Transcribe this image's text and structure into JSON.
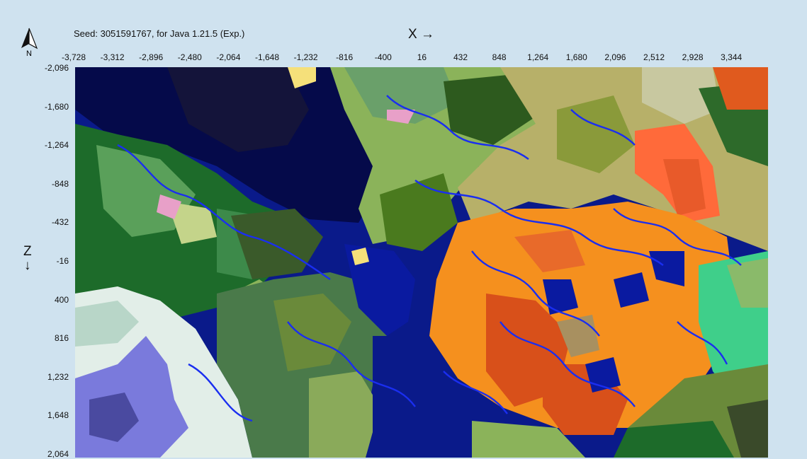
{
  "header": {
    "seed_text": "Seed: 3051591767, for Java 1.21.5 (Exp.)",
    "x_axis_label": "X →",
    "z_axis_label_line1": "Z",
    "z_axis_label_line2": "↓",
    "north_label": "N"
  },
  "x_ticks": [
    "-3,728",
    "-3,312",
    "-2,896",
    "-2,480",
    "-2,064",
    "-1,648",
    "-1,232",
    "-816",
    "-400",
    "16",
    "432",
    "848",
    "1,264",
    "1,680",
    "2,096",
    "2,512",
    "2,928",
    "3,344"
  ],
  "z_ticks": [
    "-2,096",
    "-1,680",
    "-1,264",
    "-848",
    "-432",
    "-16",
    "400",
    "816",
    "1,232",
    "1,648",
    "2,064"
  ],
  "icons": {
    "north": "north-arrow-icon"
  },
  "colors": {
    "deep_ocean": "#050a4a",
    "ocean": "#0a1a8a",
    "river": "#1a2ef0",
    "forest": "#1d6b2a",
    "dark_forest": "#2d5a1e",
    "plains": "#8bb35a",
    "savanna": "#b7b069",
    "badlands": "#f5901e",
    "eroded_badlands": "#d8501a",
    "snowy": "#e2eee8",
    "ice": "#7a7adc",
    "jungle": "#3fcf8a",
    "beach": "#f5e07a"
  }
}
